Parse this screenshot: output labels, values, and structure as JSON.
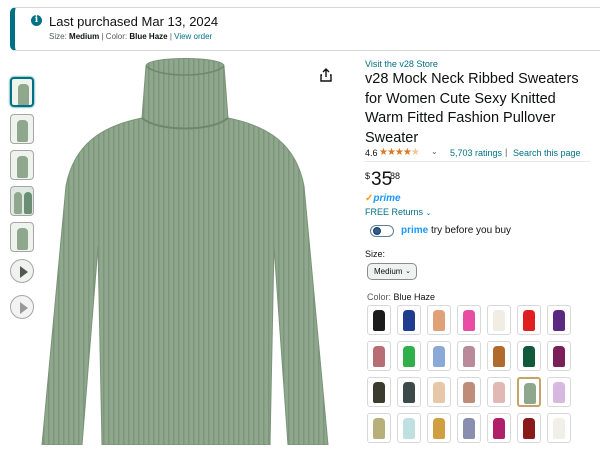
{
  "banner": {
    "title": "Last purchased Mar 13, 2024",
    "size_label": "Size:",
    "size_value": "Medium",
    "color_label": "Color:",
    "color_value": "Blue Haze",
    "view_order": "View order"
  },
  "product": {
    "store_link": "Visit the v28 Store",
    "title": "v28 Mock Neck Ribbed Sweaters for Women Cute Sexy Knitted Warm Fitted Fashion Pullover Sweater",
    "rating": "4.6",
    "ratings_count": "5,703 ratings",
    "search_page": "Search this page",
    "price_symbol": "$",
    "price_whole": "35",
    "price_fraction": "88",
    "prime": "prime",
    "free_returns": "FREE Returns",
    "try_prime": "prime",
    "try_text": "try before you buy",
    "size_label": "Size:",
    "size_selected": "Medium",
    "color_label": "Color:",
    "color_selected": "Blue Haze"
  },
  "icons": {
    "info": "info-icon",
    "share": "share-icon",
    "star": "star-icon",
    "chevron": "chevron-down-icon",
    "play": "play-icon"
  },
  "colors": {
    "accent": "#007185",
    "prime_blue": "#1a98ff",
    "star_orange": "#de7921",
    "sweater": "#8fa88d"
  },
  "swatch_colors": [
    "#1b1b1b",
    "#1f3c8f",
    "#e0a078",
    "#e94ca3",
    "#f1ede4",
    "#e02020",
    "#5a2a82",
    "#b86c73",
    "#2fb04a",
    "#8aa9d6",
    "#b88a9a",
    "#b06a2d",
    "#0f5a3a",
    "#7a1f5a",
    "#3b3b2e",
    "#3c4a4a",
    "#e6c8a8",
    "#c08c7a",
    "#e2b8b5",
    "#8fa88d",
    "#d8b8e0",
    "#b8b07a",
    "#bfe0e0",
    "#d0a040",
    "#8a8fb0",
    "#b0206a",
    "#8a1a1a",
    "#f0efe8"
  ]
}
